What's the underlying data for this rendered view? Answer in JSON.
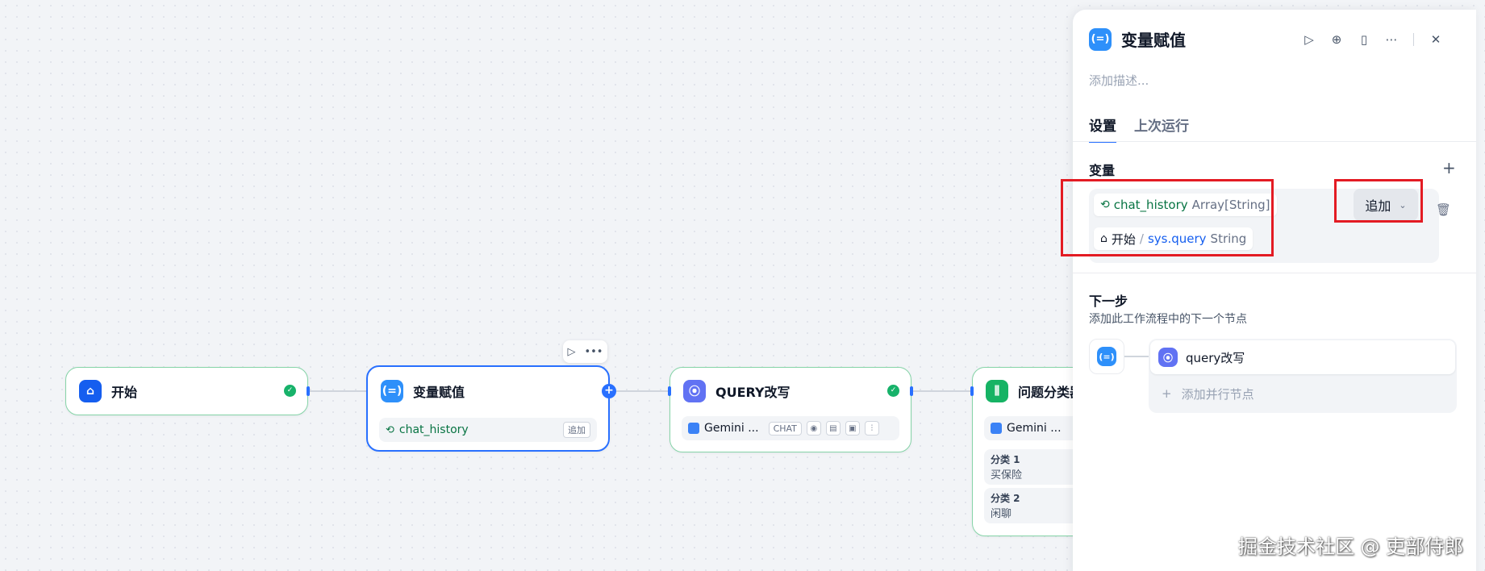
{
  "canvas": {
    "nodes": [
      {
        "title": "开始",
        "icon": "home-icon"
      },
      {
        "title": "变量赋值",
        "chip_var": "chat_history",
        "chip_action": "追加"
      },
      {
        "title": "QUERY改写",
        "model": "Gemini ...",
        "badge": "CHAT"
      },
      {
        "title": "问题分类器",
        "model": "Gemini ...",
        "classes": [
          {
            "label": "分类 1",
            "value": "买保险"
          },
          {
            "label": "分类 2",
            "value": "闲聊"
          }
        ]
      }
    ]
  },
  "panel": {
    "title": "变量赋值",
    "description_placeholder": "添加描述...",
    "tabs": [
      {
        "label": "设置"
      },
      {
        "label": "上次运行"
      }
    ],
    "variables_label": "变量",
    "variable": {
      "name": "chat_history",
      "type": "Array[String]"
    },
    "operation": "追加",
    "source": {
      "node": "开始",
      "separator": "/",
      "var": "sys.query",
      "type": "String"
    },
    "next_step": {
      "title": "下一步",
      "subtitle": "添加此工作流程中的下一个节点",
      "next_node": "query改写",
      "add_parallel": "添加并行节点"
    }
  },
  "watermark": "掘金技术社区 @ 吏部侍郎",
  "colors": {
    "accent": "#2970ff",
    "success": "#17b26a",
    "highlight": "#e31b23",
    "var_green": "#087443"
  }
}
